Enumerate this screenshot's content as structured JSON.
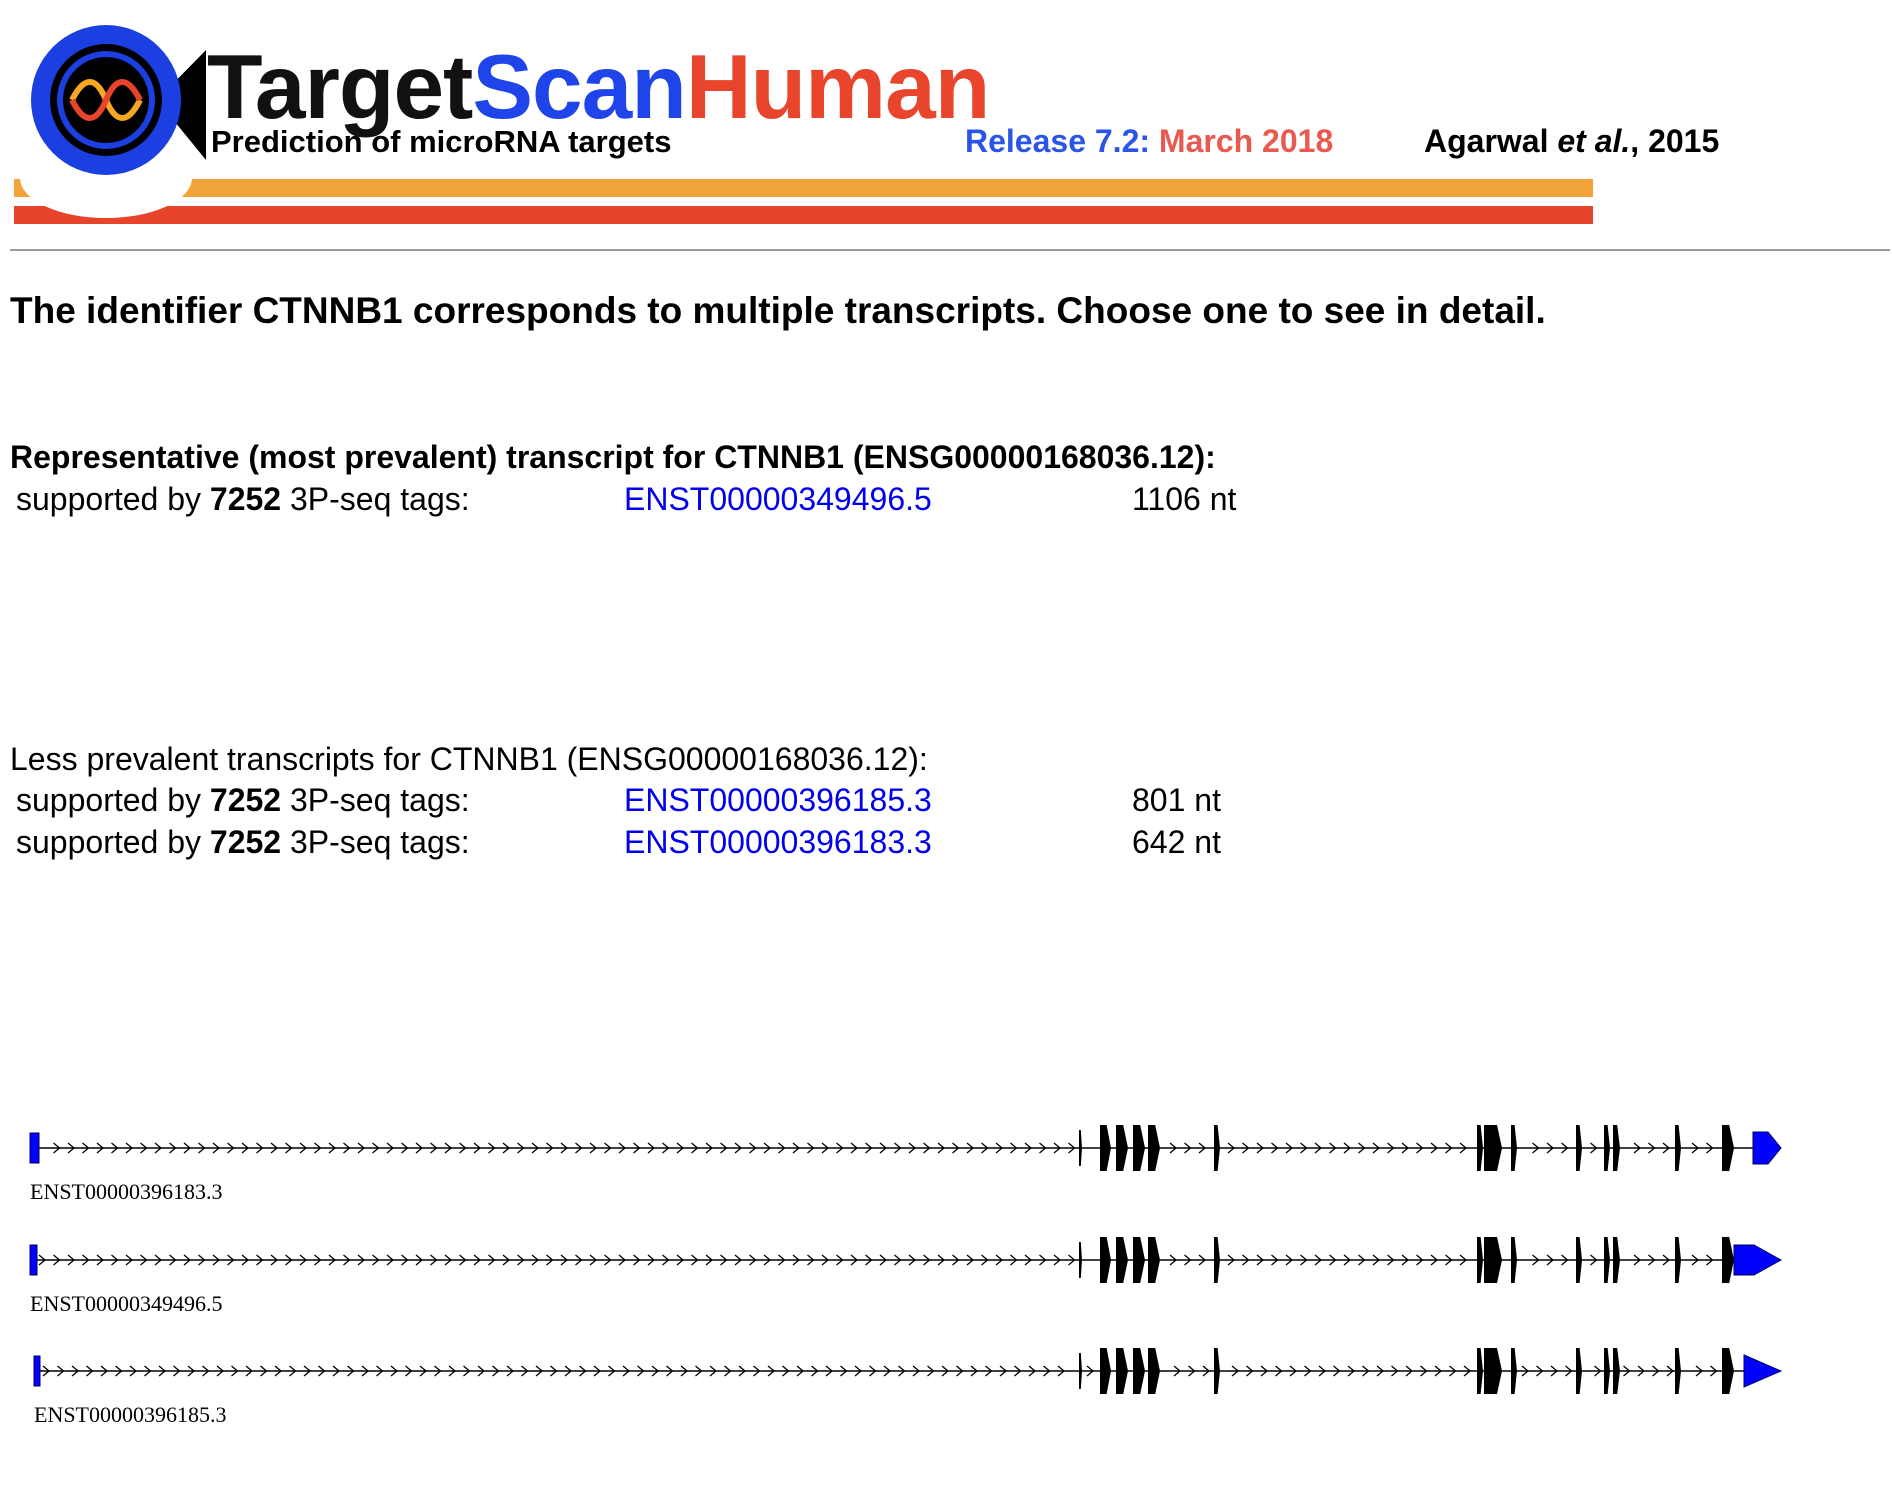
{
  "header": {
    "brand": {
      "part1": "Target",
      "part2": "Scan",
      "part3": "Human"
    },
    "tagline": "Prediction of microRNA targets",
    "release": {
      "label": "Release 7.2:",
      "date": "March 2018"
    },
    "citation": {
      "author": "Agarwal",
      "etal": "et al.",
      "year": ", 2015"
    },
    "logo_icon": "dna-helix-target-icon"
  },
  "heading": "The identifier CTNNB1 corresponds to multiple transcripts. Choose one to see in detail.",
  "representative": {
    "title": "Representative (most prevalent) transcript for CTNNB1 (ENSG00000168036.12):",
    "rows": [
      {
        "prefix": "supported by",
        "count": "7252",
        "suffix": "3P-seq tags:",
        "transcript": "ENST00000349496.5",
        "length": "1106 nt"
      }
    ]
  },
  "less_prevalent": {
    "title": "Less prevalent transcripts for CTNNB1 (ENSG00000168036.12):",
    "rows": [
      {
        "prefix": "supported by",
        "count": "7252",
        "suffix": "3P-seq tags:",
        "transcript": "ENST00000396185.3",
        "length": "801 nt"
      },
      {
        "prefix": "supported by",
        "count": "7252",
        "suffix": "3P-seq tags:",
        "transcript": "ENST00000396183.3",
        "length": "642 nt"
      }
    ]
  },
  "diagrams": [
    {
      "label": "ENST00000396183.3"
    },
    {
      "label": "ENST00000349496.5"
    },
    {
      "label": "ENST00000396185.3"
    }
  ],
  "colors": {
    "brand_dark": "#111111",
    "brand_scan": "#1f45ea",
    "brand_human": "#e8452c",
    "release_label": "#2a55e6",
    "release_date": "#e85a4f",
    "bar_orange": "#f2a33a",
    "bar_red": "#e8432b",
    "logo_blue": "#1b3fe0",
    "logo_orange": "#f5a623",
    "logo_red": "#e8432b",
    "link": "#0000ee",
    "utr": "#0000ff",
    "cds": "#000000"
  }
}
